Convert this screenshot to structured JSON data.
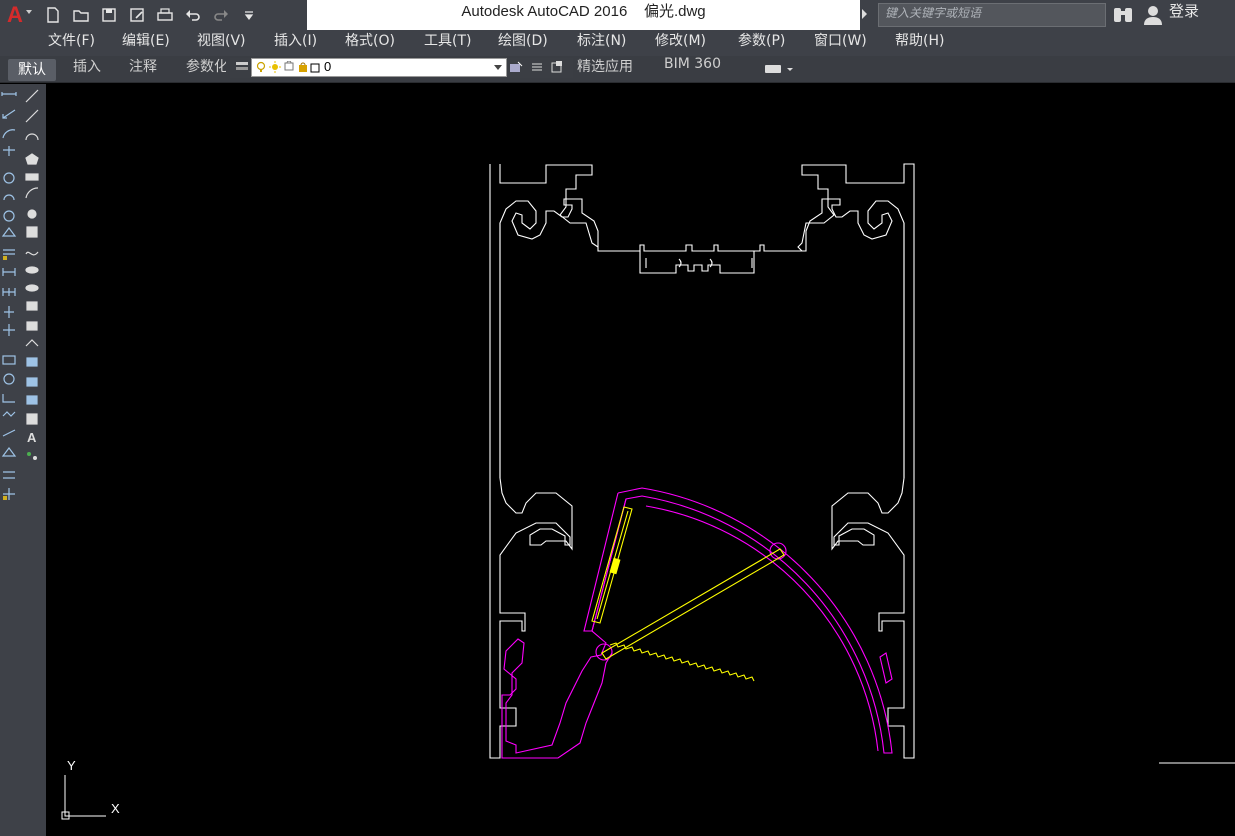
{
  "app": {
    "title": "Autodesk AutoCAD 2016    偏光.dwg",
    "search_placeholder": "键入关键字或短语",
    "login_label": "登录"
  },
  "quick_access": [
    "new-icon",
    "open-icon",
    "save-icon",
    "saveas-icon",
    "print-icon",
    "undo-icon",
    "redo-icon",
    "more-icon"
  ],
  "menu": [
    "文件(F)",
    "编辑(E)",
    "视图(V)",
    "插入(I)",
    "格式(O)",
    "工具(T)",
    "绘图(D)",
    "标注(N)",
    "修改(M)",
    "参数(P)",
    "窗口(W)",
    "帮助(H)"
  ],
  "ribbon_tabs": {
    "default": "默认",
    "insert": "插入",
    "annotate": "注释",
    "parametric": "参数化",
    "featured": "精选应用",
    "bim": "BIM 360"
  },
  "layer": {
    "current": "0"
  },
  "ucs": {
    "x_label": "X",
    "y_label": "Y"
  },
  "colors": {
    "outline": "#ffffff",
    "magenta": "#ff00ff",
    "yellow": "#ffff00",
    "chrome": "#3e4148",
    "accent": "#d42b2b"
  }
}
